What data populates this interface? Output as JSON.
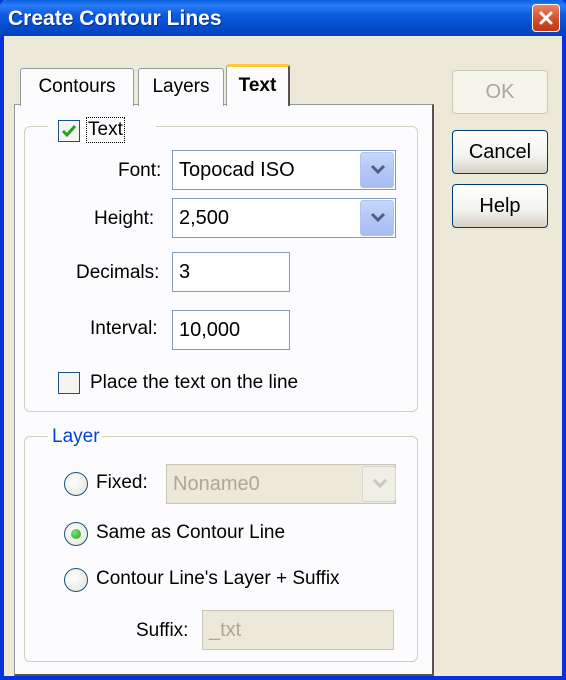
{
  "window": {
    "title": "Create Contour Lines"
  },
  "tabs": [
    {
      "label": "Contours"
    },
    {
      "label": "Layers"
    },
    {
      "label": "Text"
    }
  ],
  "text_group": {
    "checkbox_label": "Text",
    "checked": true,
    "font_label": "Font:",
    "font_value": "Topocad ISO",
    "height_label": "Height:",
    "height_value": "2,500",
    "decimals_label": "Decimals:",
    "decimals_value": "3",
    "interval_label": "Interval:",
    "interval_value": "10,000",
    "place_on_line_label": "Place the text on the line",
    "place_on_line_checked": false
  },
  "layer_group": {
    "title": "Layer",
    "fixed_label": "Fixed:",
    "fixed_value": "Noname0",
    "same_as_label": "Same as Contour Line",
    "suffix_option_label": "Contour Line's Layer + Suffix",
    "selected": "same_as_contour",
    "suffix_label": "Suffix:",
    "suffix_value": "_txt"
  },
  "buttons": {
    "ok": "OK",
    "cancel": "Cancel",
    "help": "Help"
  },
  "colors": {
    "title_bar": "#0a5fe0",
    "group_title": "#0046d5",
    "tab_highlight": "#ffc83c"
  }
}
